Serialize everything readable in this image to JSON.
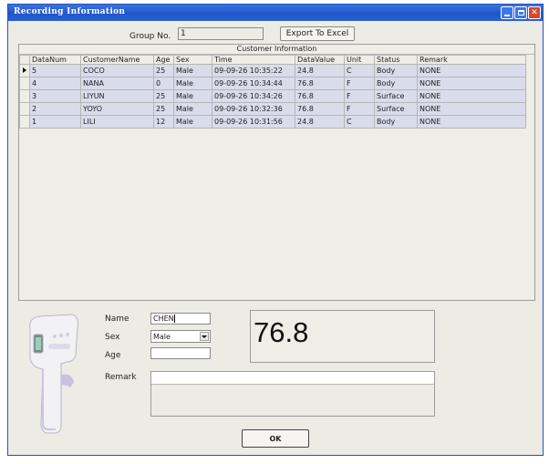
{
  "window": {
    "title": "Recording Information"
  },
  "toolbar": {
    "group_label": "Group No.",
    "group_value": "1",
    "export_label": "Export To Excel"
  },
  "grid": {
    "caption": "Customer Information",
    "columns": [
      "DataNum",
      "CustomerName",
      "Age",
      "Sex",
      "Time",
      "DataValue",
      "Unit",
      "Status",
      "Remark"
    ],
    "rows": [
      [
        "5",
        "COCO",
        "25",
        "Male",
        "09-09-26 10:35:22",
        "24.8",
        "C",
        "Body",
        "NONE"
      ],
      [
        "4",
        "NANA",
        "0",
        "Male",
        "09-09-26 10:34:44",
        "76.8",
        "F",
        "Body",
        "NONE"
      ],
      [
        "3",
        "LIYUN",
        "25",
        "Male",
        "09-09-26 10:34:26",
        "76.8",
        "F",
        "Surface",
        "NONE"
      ],
      [
        "2",
        "YOYO",
        "25",
        "Male",
        "09-09-26 10:32:36",
        "76.8",
        "F",
        "Surface",
        "NONE"
      ],
      [
        "1",
        "LILI",
        "12",
        "Male",
        "09-09-26 10:31:56",
        "24.8",
        "C",
        "Body",
        "NONE"
      ]
    ]
  },
  "form": {
    "name_label": "Name",
    "name_value": "CHEN",
    "sex_label": "Sex",
    "sex_value": "Male",
    "age_label": "Age",
    "age_value": "",
    "remark_label": "Remark",
    "remark_value": "",
    "reading": "76.8"
  },
  "footer": {
    "ok_label": "OK"
  }
}
